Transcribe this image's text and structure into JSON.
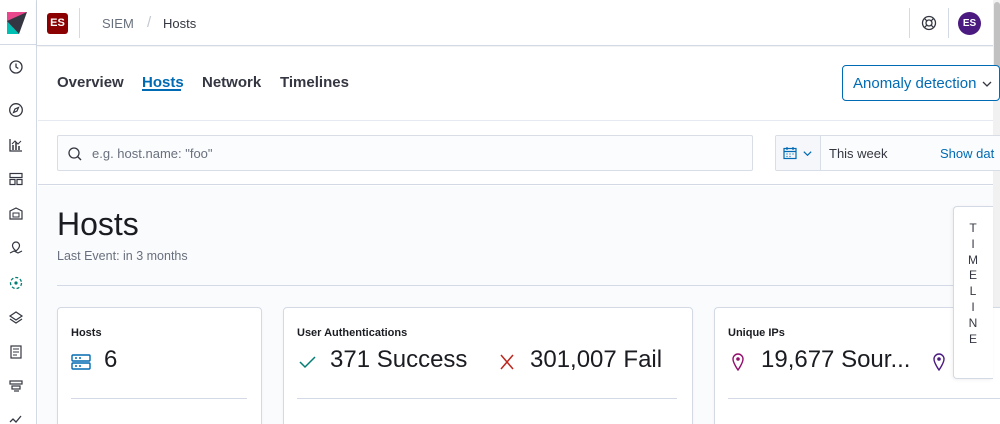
{
  "header": {
    "space_badge": "ES",
    "breadcrumbs": [
      "SIEM",
      "Hosts"
    ],
    "breadcrumb_separator": "/",
    "user_initials": "ES"
  },
  "nav": {
    "tabs": [
      {
        "label": "Overview",
        "active": false
      },
      {
        "label": "Hosts",
        "active": true
      },
      {
        "label": "Network",
        "active": false
      },
      {
        "label": "Timelines",
        "active": false
      }
    ],
    "anomaly_button": "Anomaly detection"
  },
  "search": {
    "placeholder": "e.g. host.name: \"foo\"",
    "value": ""
  },
  "date_picker": {
    "range": "This week",
    "show_dates": "Show dat"
  },
  "page": {
    "title": "Hosts",
    "last_event": "Last Event: in 3 months"
  },
  "cards": [
    {
      "title": "Hosts",
      "stats": [
        {
          "icon": "server-icon",
          "value": "6"
        }
      ]
    },
    {
      "title": "User Authentications",
      "stats": [
        {
          "icon": "check-icon",
          "value": "371 Success"
        },
        {
          "icon": "cross-icon",
          "value": "301,007 Fail"
        }
      ]
    },
    {
      "title": "Unique IPs",
      "stats": [
        {
          "icon": "map-pin-icon",
          "value": "19,677 Sour..."
        },
        {
          "icon": "map-pin-icon",
          "value": ""
        }
      ]
    }
  ],
  "timeline_tab": {
    "letters": [
      "T",
      "I",
      "M",
      "E",
      "L",
      "I",
      "N",
      "E"
    ]
  },
  "colors": {
    "accent": "#006bb4",
    "space_badge_bg": "#8b0000",
    "avatar_bg": "#4b1a80",
    "success": "#017d73",
    "fail": "#bd271e",
    "ip_pin": "#920e6b"
  }
}
